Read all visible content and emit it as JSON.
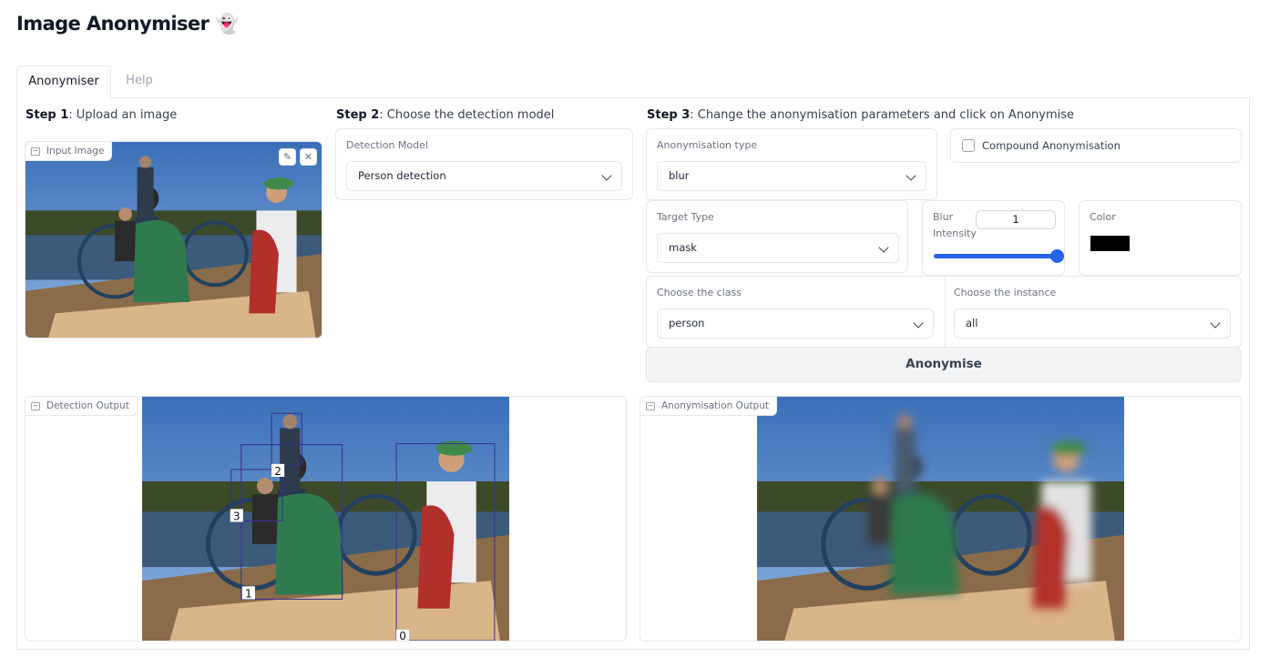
{
  "app": {
    "title": "Image Anonymiser 👻"
  },
  "tabs": [
    {
      "label": "Anonymiser",
      "active": true
    },
    {
      "label": "Help",
      "active": false
    }
  ],
  "step1": {
    "prefix": "Step 1",
    "text": ": Upload an image",
    "image_label": "Input Image"
  },
  "step2": {
    "prefix": "Step 2",
    "text": ": Choose the detection model",
    "model_label": "Detection Model",
    "model_value": "Person detection"
  },
  "step3": {
    "prefix": "Step 3",
    "text": ": Change the anonymisation parameters and click on Anonymise",
    "anon_type_label": "Anonymisation type",
    "anon_type_value": "blur",
    "compound_label": "Compound Anonymisation",
    "compound_checked": false,
    "target_type_label": "Target Type",
    "target_type_value": "mask",
    "blur_label_1": "Blur",
    "blur_label_2": "Intensity",
    "blur_value": "1",
    "blur_level": 1.0,
    "color_label": "Color",
    "color_value": "#000000",
    "class_label": "Choose the class",
    "class_value": "person",
    "instance_label": "Choose the instance",
    "instance_value": "all",
    "anonymise_button": "Anonymise"
  },
  "outputs": {
    "detection_label": "Detection Output",
    "anonymisation_label": "Anonymisation Output",
    "detection_ids": [
      "0",
      "1",
      "2",
      "3"
    ]
  },
  "icons": {
    "edit": "pencil-icon",
    "clear": "close-icon",
    "image": "image-icon",
    "dropdown": "chevron-down-icon"
  },
  "colors": {
    "accent": "#2563eb",
    "bbox": "#3b2f8f"
  }
}
